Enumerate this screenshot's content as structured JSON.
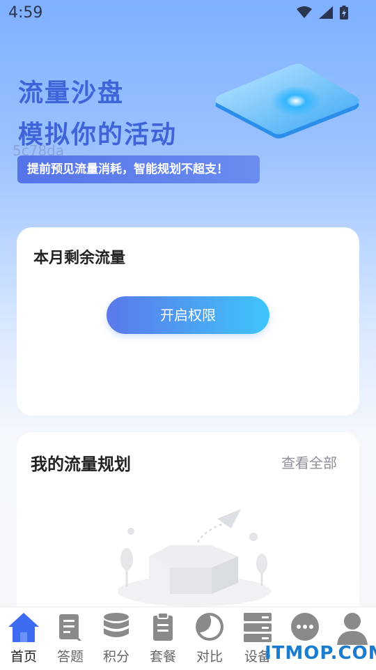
{
  "status": {
    "time": "4:59"
  },
  "hero": {
    "title_line1": "流量沙盘",
    "title_line2": "模拟你的活动",
    "code": "5c78da",
    "banner": "提前预见流量消耗，智能规划不超支！"
  },
  "remaining_card": {
    "title": "本月剩余流量",
    "button_label": "开启权限"
  },
  "plan_card": {
    "title": "我的流量规划",
    "view_all": "查看全部"
  },
  "tabs": [
    {
      "label": "首页",
      "icon": "home-icon",
      "active": true
    },
    {
      "label": "答题",
      "icon": "quiz-icon"
    },
    {
      "label": "积分",
      "icon": "coins-icon"
    },
    {
      "label": "套餐",
      "icon": "clipboard-icon"
    },
    {
      "label": "对比",
      "icon": "compare-icon"
    },
    {
      "label": "设备",
      "icon": "server-icon"
    },
    {
      "label": "",
      "icon": "more-icon"
    },
    {
      "label": "",
      "icon": "user-icon"
    }
  ],
  "watermark": "ITMOP.COM",
  "colors": {
    "accent": "#4a6cf0",
    "active_tab": "#3d6bf2",
    "inactive_tab": "#8a8a8a"
  }
}
